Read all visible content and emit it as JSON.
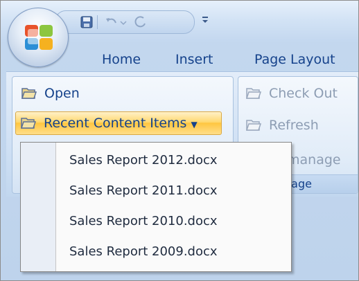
{
  "tabs": [
    "Home",
    "Insert",
    "Page Layout"
  ],
  "groups": {
    "left": {
      "open_label": "Open",
      "recent_label": "Recent Content Items"
    },
    "right": {
      "check_out_label": "Check Out",
      "refresh_label": "Refresh",
      "manage_label": "manage",
      "group_label": "nage"
    }
  },
  "menu": {
    "items": [
      "Sales Report 2012.docx",
      "Sales Report 2011.docx",
      "Sales Report 2010.docx",
      "Sales Report 2009.docx"
    ]
  },
  "icons": {
    "office": "office-logo-icon",
    "save": "save-icon",
    "undo": "undo-icon",
    "redo": "redo-icon",
    "qat_dropdown": "chevron-down-icon",
    "folder": "folder-icon"
  },
  "colors": {
    "ribbon_text": "#15428b",
    "highlight": "#ffc640",
    "disabled_text": "#8d9db3"
  }
}
